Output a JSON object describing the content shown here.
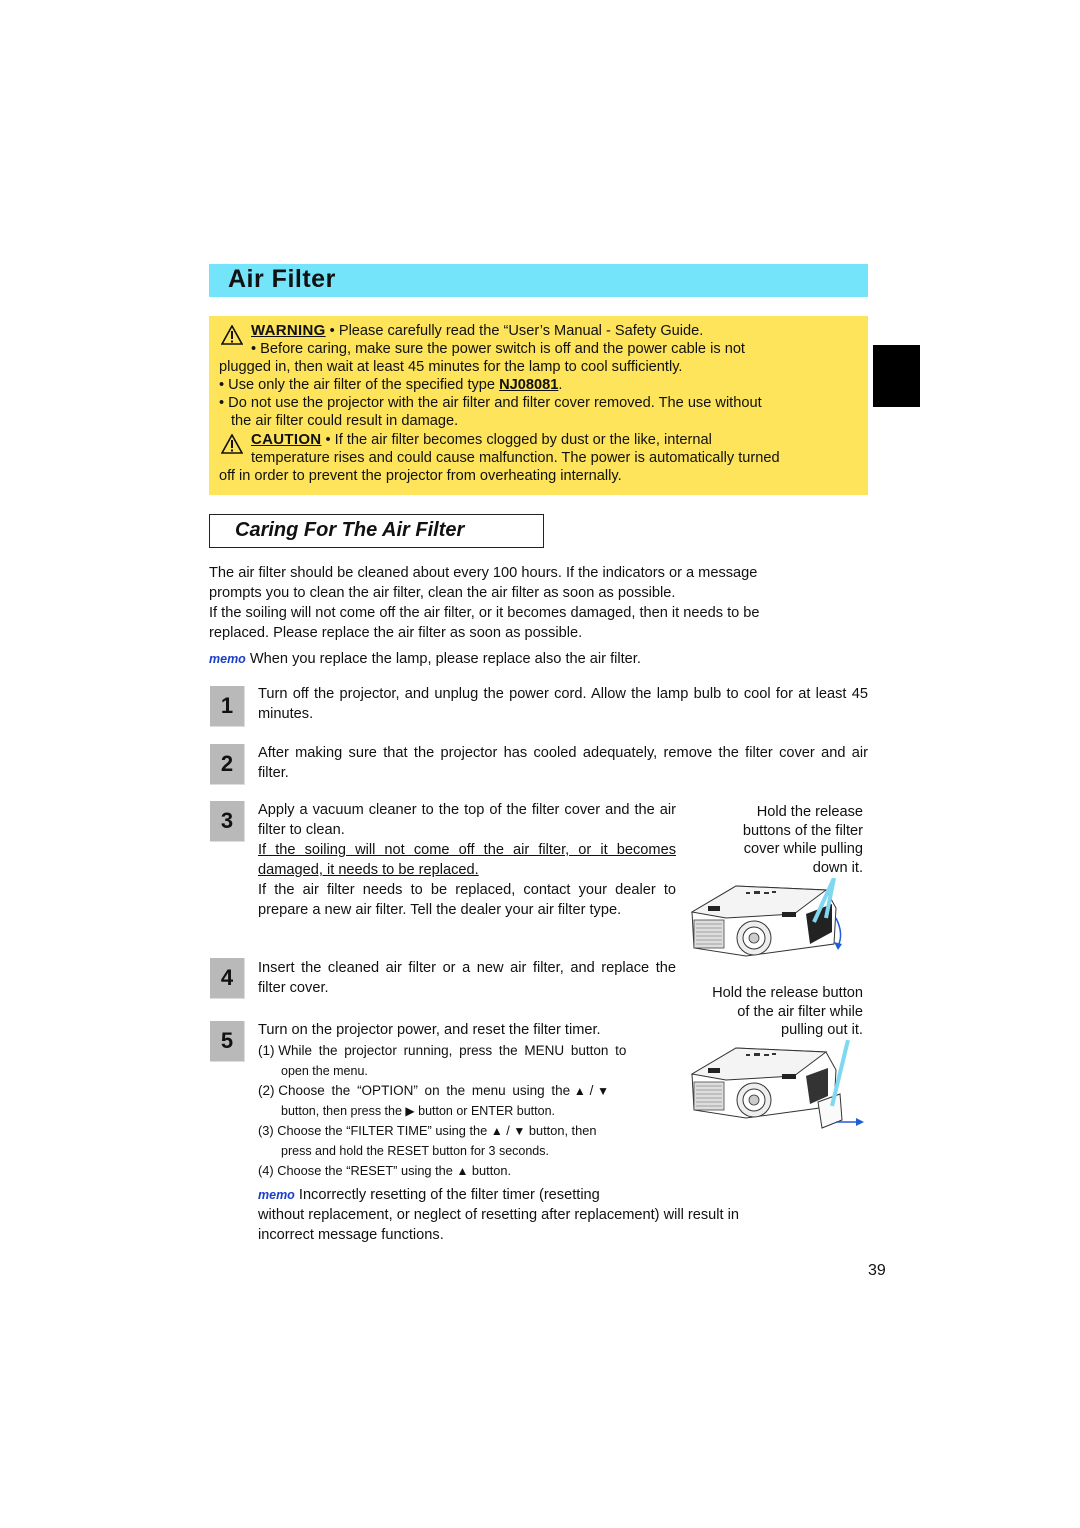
{
  "page": {
    "title": "Air Filter",
    "page_number": "39"
  },
  "warning_box": {
    "warning_label": "WARNING",
    "warning_lines": [
      "• Please carefully read the “User’s Manual - Safety Guide.",
      "• Before caring, make sure the power switch is off and the power cable is not",
      "plugged in, then wait at least 45 minutes for the lamp to cool sufficiently."
    ],
    "filter_type_prefix": "• Use only the air filter of the specified type ",
    "filter_type": "NJ08081",
    "filter_type_suffix": ".",
    "no_use_lines": [
      "• Do not use the projector with the air filter and filter cover removed. The use without",
      "the air filter could result in damage."
    ],
    "caution_label": "CAUTION",
    "caution_lines": [
      "• If the air filter becomes clogged by dust or the like, internal",
      "temperature rises and could cause malfunction. The power is automatically turned",
      "off in order to prevent the projector from overheating internally."
    ],
    "icons": [
      "warning-triangle-icon",
      "caution-triangle-icon"
    ]
  },
  "section": {
    "title": "Caring For The Air Filter",
    "intro_lines": [
      "The air filter should be cleaned about every 100 hours. If the indicators or a message",
      "prompts you to clean the air filter, clean the air filter as soon as possible.",
      "If the soiling will not come off the air filter, or it becomes damaged, then it needs to be",
      "replaced. Please replace the air filter as soon as possible."
    ],
    "memo_label": "memo",
    "memo_text": "When you replace the lamp, please replace also the air filter."
  },
  "steps": [
    {
      "number": "1",
      "text": "Turn off the projector, and unplug the power cord. Allow the lamp bulb to cool for at least 45 minutes."
    },
    {
      "number": "2",
      "text": "After making sure that the projector has cooled adequately, remove the filter cover and air filter."
    },
    {
      "number": "3",
      "text": "Apply a vacuum cleaner to the top of the filter cover and the air filter to clean.",
      "underlined": "If the soiling will not come off the air filter, or it becomes damaged, it needs to be replaced.",
      "extra": "If the air filter needs to be replaced, contact your dealer to prepare a new air filter. Tell the dealer your air filter type."
    },
    {
      "number": "4",
      "text": "Insert the cleaned air filter or a new air filter, and replace the filter cover."
    },
    {
      "number": "5",
      "text": "Turn on the projector power, and reset the filter timer.",
      "substeps": [
        {
          "n": "(1)",
          "a": "While the projector running, press the MENU button to",
          "b": "open the menu."
        },
        {
          "n": "(2)",
          "a": "Choose the “OPTION” on the menu using the",
          "a2": "/",
          "b": "button, then press the",
          "b2": "button or ENTER button."
        },
        {
          "n": "(3)",
          "a": "Choose the “FILTER TIME” using the",
          "a2": "/",
          "a3": "button, then",
          "b": "press and hold the RESET button for 3 seconds."
        },
        {
          "n": "(4)",
          "a": "Choose the “RESET” using the",
          "a2": "button."
        }
      ]
    }
  ],
  "glyphs": {
    "up": "▲",
    "down": "▼",
    "right": "▶"
  },
  "figures": [
    {
      "caption_lines": [
        "Hold the release",
        "buttons of the filter",
        "cover while pulling",
        "down it."
      ],
      "name": "projector-filter-cover-illustration"
    },
    {
      "caption_lines": [
        "Hold the release button",
        "of the air filter while",
        "pulling out it."
      ],
      "name": "projector-air-filter-illustration"
    }
  ],
  "footer_memo": {
    "label": "memo",
    "line1": "Incorrectly resetting of the filter timer (resetting",
    "line2": "without replacement, or neglect of resetting after replacement) will result in",
    "line3": "incorrect message functions."
  },
  "colors": {
    "title_bar": "#74e4fb",
    "warning_box": "#fde45a",
    "memo": "#1a3fc8",
    "step_box": "#b9b9b9",
    "highlight_lines": "#7fd8f0",
    "arrow": "#1e5fd8"
  }
}
